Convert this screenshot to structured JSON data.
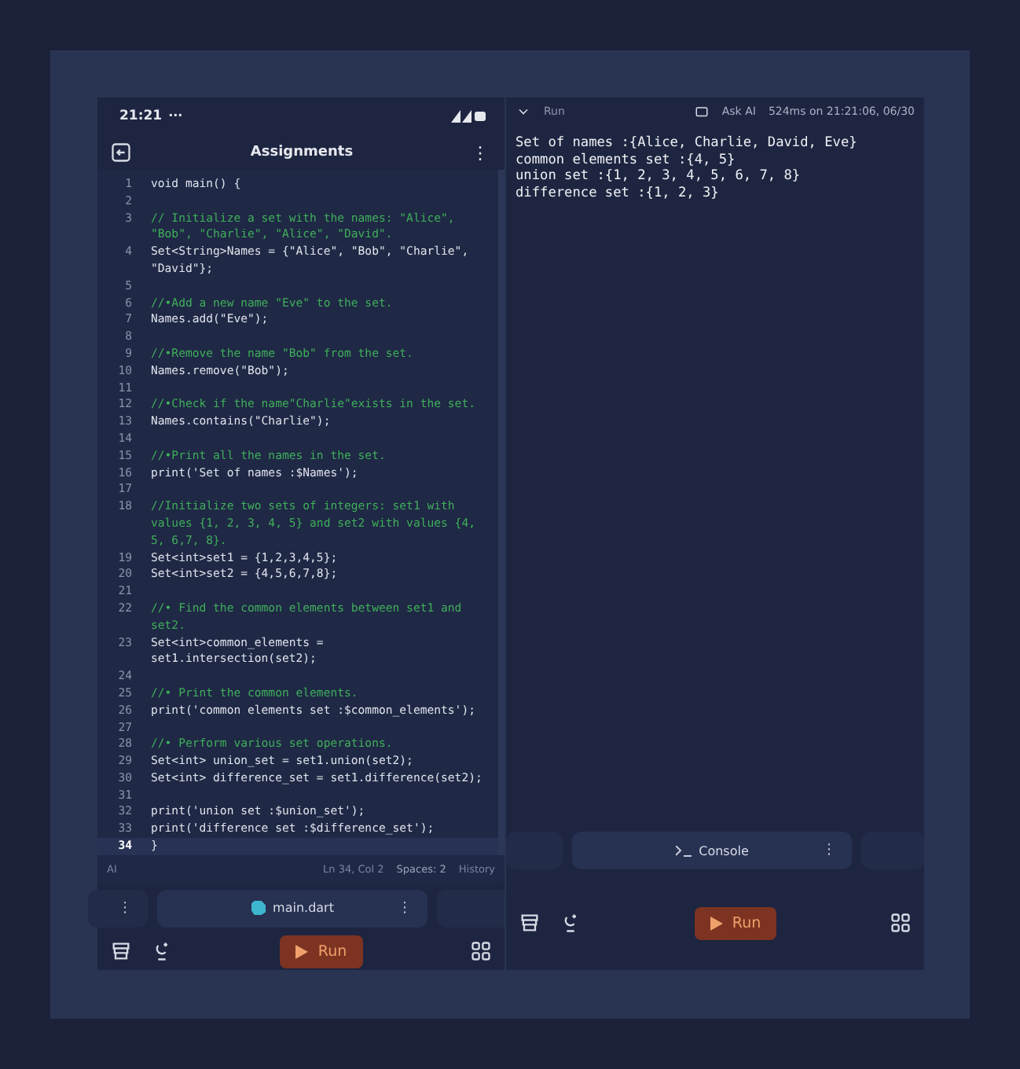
{
  "status_bar": {
    "time": "21:21",
    "dots": "···"
  },
  "editor": {
    "title": "Assignments",
    "menu": "⋮",
    "lines": [
      {
        "number": "1",
        "kind": "code",
        "text": "void main() {",
        "current": false
      },
      {
        "number": "2",
        "current": false
      },
      {
        "number": "3",
        "kind": "comment",
        "text": "// Initialize a set with the names: \"Alice\", \"Bob\", \"Charlie\", \"Alice\", \"David\".",
        "current": false
      },
      {
        "number": "4",
        "kind": "code",
        "text": "Set<String>Names = {\"Alice\", \"Bob\", \"Charlie\", \"David\"};",
        "current": false
      },
      {
        "number": "5",
        "current": false
      },
      {
        "number": "6",
        "kind": "comment",
        "text": "//•Add a new name \"Eve\" to the set.",
        "current": false
      },
      {
        "number": "7",
        "kind": "code",
        "text": "Names.add(\"Eve\");",
        "current": false
      },
      {
        "number": "8",
        "current": false
      },
      {
        "number": "9",
        "kind": "comment",
        "text": "//•Remove the name \"Bob\" from the set.",
        "current": false
      },
      {
        "number": "10",
        "kind": "code",
        "text": "Names.remove(\"Bob\");",
        "current": false
      },
      {
        "number": "11",
        "current": false
      },
      {
        "number": "12",
        "kind": "comment",
        "text": "//•Check if the name\"Charlie\"exists in the set.",
        "current": false
      },
      {
        "number": "13",
        "kind": "code",
        "text": "Names.contains(\"Charlie\");",
        "current": false
      },
      {
        "number": "14",
        "current": false
      },
      {
        "number": "15",
        "kind": "comment",
        "text": "//•Print all the names in the set.",
        "current": false
      },
      {
        "number": "16",
        "kind": "code",
        "text": "print('Set of names :$Names');",
        "current": false
      },
      {
        "number": "17",
        "current": false
      },
      {
        "number": "18",
        "kind": "comment",
        "text": "//Initialize two sets of integers: set1 with values {1, 2, 3, 4, 5} and set2 with values {4, 5, 6,7, 8}.",
        "current": false
      },
      {
        "number": "19",
        "kind": "code",
        "text": "Set<int>set1 = {1,2,3,4,5};",
        "current": false
      },
      {
        "number": "20",
        "kind": "code",
        "text": "Set<int>set2 = {4,5,6,7,8};",
        "current": false
      },
      {
        "number": "21",
        "current": false
      },
      {
        "number": "22",
        "kind": "comment",
        "text": "//• Find the common elements between set1 and set2.",
        "current": false
      },
      {
        "number": "23",
        "kind": "code",
        "text": "Set<int>common_elements = set1.intersection(set2);",
        "current": false
      },
      {
        "number": "24",
        "current": false
      },
      {
        "number": "25",
        "kind": "comment",
        "text": "//• Print the common elements.",
        "current": false
      },
      {
        "number": "26",
        "kind": "code",
        "text": "print('common elements set :$common_elements');",
        "current": false
      },
      {
        "number": "27",
        "current": false
      },
      {
        "number": "28",
        "kind": "comment",
        "text": "//• Perform various set operations.",
        "current": false
      },
      {
        "number": "29",
        "kind": "code",
        "text": "Set<int> union_set = set1.union(set2);",
        "current": false
      },
      {
        "number": "30",
        "kind": "code",
        "text": "Set<int> difference_set = set1.difference(set2);",
        "current": false
      },
      {
        "number": "31",
        "current": false
      },
      {
        "number": "32",
        "kind": "code",
        "text": "print('union set :$union_set');",
        "current": false
      },
      {
        "number": "33",
        "kind": "code",
        "text": "print('difference set :$difference_set');",
        "current": false
      },
      {
        "number": "34",
        "kind": "code",
        "text": "}",
        "current": true
      }
    ],
    "footer": {
      "ai": "AI",
      "position": "Ln 34, Col 2",
      "spaces": "Spaces: 2",
      "history": "History"
    }
  },
  "file_tabs": {
    "left_menu": "⋮",
    "file": "main.dart",
    "file_menu": "⋮"
  },
  "left_run_button": "Run",
  "output": {
    "tab": "Run",
    "ask_ai": "Ask AI",
    "timing": "524ms on 21:21:06, 06/30",
    "lines": [
      "Set of names :{Alice, Charlie, David, Eve}",
      "common elements set :{4, 5}",
      "union set :{1, 2, 3, 4, 5, 6, 7, 8}",
      "difference set :{1, 2, 3}"
    ]
  },
  "console_tab": {
    "label": "Console",
    "menu": "⋮"
  },
  "right_run_button": "Run"
}
